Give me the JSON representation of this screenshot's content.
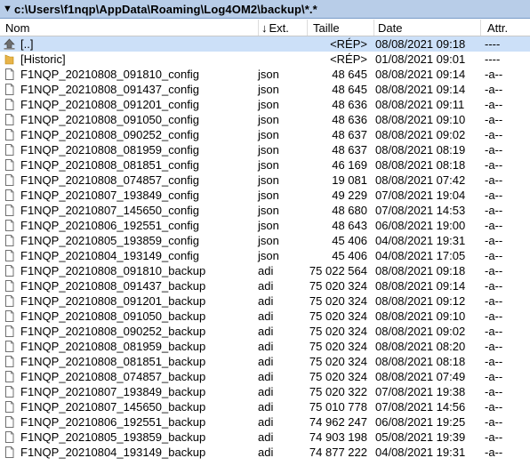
{
  "path": "c:\\Users\\f1nqp\\AppData\\Roaming\\Log4OM2\\backup\\*.*",
  "columns": {
    "name": "Nom",
    "ext_arrow": "↓",
    "ext": "Ext.",
    "size": "Taille",
    "date": "Date",
    "attr": "Attr."
  },
  "icons": {
    "up": "up-arrow-icon",
    "folder": "folder-icon",
    "file": "file-icon"
  },
  "colors": {
    "pathbar": "#b8cde8",
    "selected_row": "#cce0f8",
    "folder": "#e8b44a"
  },
  "rows": [
    {
      "icon": "up",
      "name": "[..]",
      "ext": "",
      "size": "<RÉP>",
      "date": "08/08/2021 09:18",
      "attr": "----",
      "selected": true
    },
    {
      "icon": "folder",
      "name": "[Historic]",
      "ext": "",
      "size": "<RÉP>",
      "date": "01/08/2021 09:01",
      "attr": "----"
    },
    {
      "icon": "file",
      "name": "F1NQP_20210808_091810_config",
      "ext": "json",
      "size": "48 645",
      "date": "08/08/2021 09:14",
      "attr": "-a--"
    },
    {
      "icon": "file",
      "name": "F1NQP_20210808_091437_config",
      "ext": "json",
      "size": "48 645",
      "date": "08/08/2021 09:14",
      "attr": "-a--"
    },
    {
      "icon": "file",
      "name": "F1NQP_20210808_091201_config",
      "ext": "json",
      "size": "48 636",
      "date": "08/08/2021 09:11",
      "attr": "-a--"
    },
    {
      "icon": "file",
      "name": "F1NQP_20210808_091050_config",
      "ext": "json",
      "size": "48 636",
      "date": "08/08/2021 09:10",
      "attr": "-a--"
    },
    {
      "icon": "file",
      "name": "F1NQP_20210808_090252_config",
      "ext": "json",
      "size": "48 637",
      "date": "08/08/2021 09:02",
      "attr": "-a--"
    },
    {
      "icon": "file",
      "name": "F1NQP_20210808_081959_config",
      "ext": "json",
      "size": "48 637",
      "date": "08/08/2021 08:19",
      "attr": "-a--"
    },
    {
      "icon": "file",
      "name": "F1NQP_20210808_081851_config",
      "ext": "json",
      "size": "46 169",
      "date": "08/08/2021 08:18",
      "attr": "-a--"
    },
    {
      "icon": "file",
      "name": "F1NQP_20210808_074857_config",
      "ext": "json",
      "size": "19 081",
      "date": "08/08/2021 07:42",
      "attr": "-a--"
    },
    {
      "icon": "file",
      "name": "F1NQP_20210807_193849_config",
      "ext": "json",
      "size": "49 229",
      "date": "07/08/2021 19:04",
      "attr": "-a--"
    },
    {
      "icon": "file",
      "name": "F1NQP_20210807_145650_config",
      "ext": "json",
      "size": "48 680",
      "date": "07/08/2021 14:53",
      "attr": "-a--"
    },
    {
      "icon": "file",
      "name": "F1NQP_20210806_192551_config",
      "ext": "json",
      "size": "48 643",
      "date": "06/08/2021 19:00",
      "attr": "-a--"
    },
    {
      "icon": "file",
      "name": "F1NQP_20210805_193859_config",
      "ext": "json",
      "size": "45 406",
      "date": "04/08/2021 19:31",
      "attr": "-a--"
    },
    {
      "icon": "file",
      "name": "F1NQP_20210804_193149_config",
      "ext": "json",
      "size": "45 406",
      "date": "04/08/2021 17:05",
      "attr": "-a--"
    },
    {
      "icon": "file",
      "name": "F1NQP_20210808_091810_backup",
      "ext": "adi",
      "size": "75 022 564",
      "date": "08/08/2021 09:18",
      "attr": "-a--"
    },
    {
      "icon": "file",
      "name": "F1NQP_20210808_091437_backup",
      "ext": "adi",
      "size": "75 020 324",
      "date": "08/08/2021 09:14",
      "attr": "-a--"
    },
    {
      "icon": "file",
      "name": "F1NQP_20210808_091201_backup",
      "ext": "adi",
      "size": "75 020 324",
      "date": "08/08/2021 09:12",
      "attr": "-a--"
    },
    {
      "icon": "file",
      "name": "F1NQP_20210808_091050_backup",
      "ext": "adi",
      "size": "75 020 324",
      "date": "08/08/2021 09:10",
      "attr": "-a--"
    },
    {
      "icon": "file",
      "name": "F1NQP_20210808_090252_backup",
      "ext": "adi",
      "size": "75 020 324",
      "date": "08/08/2021 09:02",
      "attr": "-a--"
    },
    {
      "icon": "file",
      "name": "F1NQP_20210808_081959_backup",
      "ext": "adi",
      "size": "75 020 324",
      "date": "08/08/2021 08:20",
      "attr": "-a--"
    },
    {
      "icon": "file",
      "name": "F1NQP_20210808_081851_backup",
      "ext": "adi",
      "size": "75 020 324",
      "date": "08/08/2021 08:18",
      "attr": "-a--"
    },
    {
      "icon": "file",
      "name": "F1NQP_20210808_074857_backup",
      "ext": "adi",
      "size": "75 020 324",
      "date": "08/08/2021 07:49",
      "attr": "-a--"
    },
    {
      "icon": "file",
      "name": "F1NQP_20210807_193849_backup",
      "ext": "adi",
      "size": "75 020 322",
      "date": "07/08/2021 19:38",
      "attr": "-a--"
    },
    {
      "icon": "file",
      "name": "F1NQP_20210807_145650_backup",
      "ext": "adi",
      "size": "75 010 778",
      "date": "07/08/2021 14:56",
      "attr": "-a--"
    },
    {
      "icon": "file",
      "name": "F1NQP_20210806_192551_backup",
      "ext": "adi",
      "size": "74 962 247",
      "date": "06/08/2021 19:25",
      "attr": "-a--"
    },
    {
      "icon": "file",
      "name": "F1NQP_20210805_193859_backup",
      "ext": "adi",
      "size": "74 903 198",
      "date": "05/08/2021 19:39",
      "attr": "-a--"
    },
    {
      "icon": "file",
      "name": "F1NQP_20210804_193149_backup",
      "ext": "adi",
      "size": "74 877 222",
      "date": "04/08/2021 19:31",
      "attr": "-a--"
    }
  ]
}
